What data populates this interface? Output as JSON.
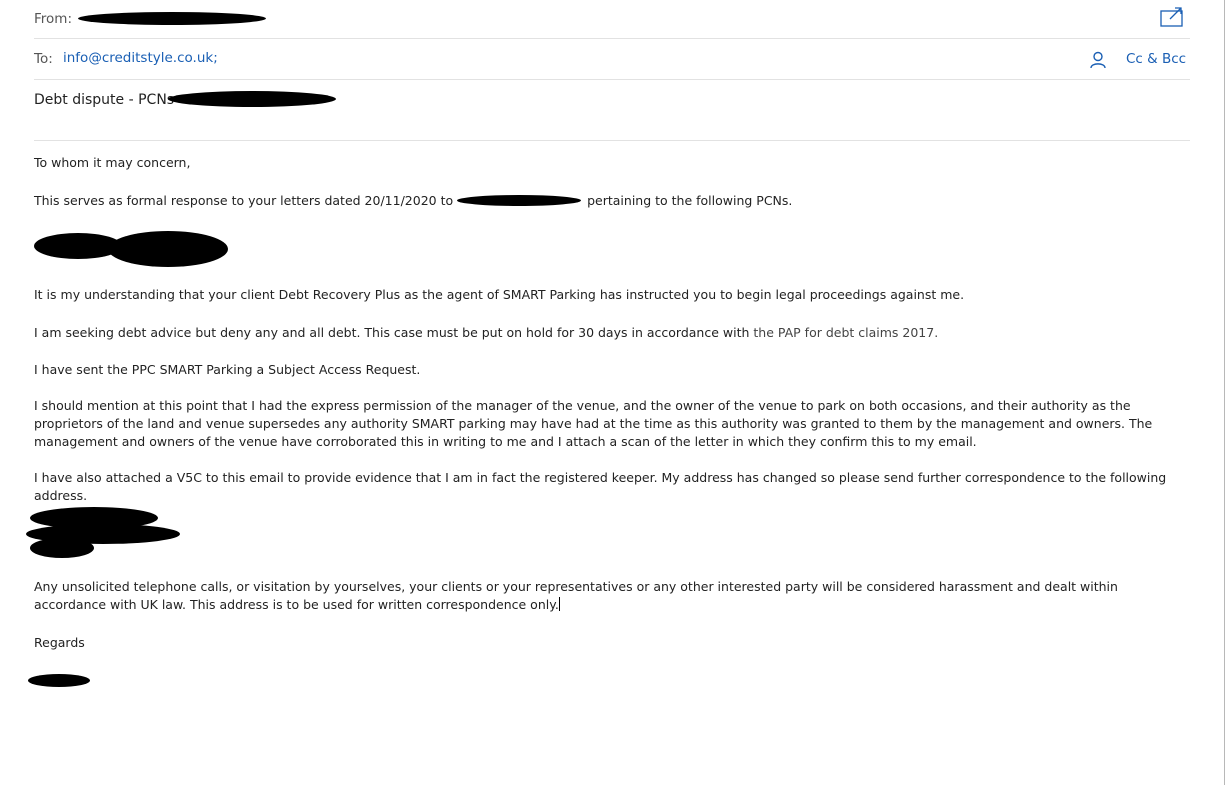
{
  "header": {
    "from_label": "From:",
    "to_label": "To:",
    "to_value": "info@creditstyle.co.uk;",
    "cc_bcc_label": "Cc & Bcc",
    "subject": "Debt dispute - PCNs"
  },
  "body": {
    "greeting": "To whom it may concern,",
    "p1_start": "This serves as formal response to your letters dated 20/11/2020 to",
    "p1_end": "pertaining to the following PCNs.",
    "p2": "It is my understanding that your client Debt Recovery Plus as the agent of SMART Parking has instructed you to begin legal proceedings against me.",
    "p3_start": "I am seeking debt advice but deny any and all debt. This case must be put on hold for 30 days in accordance with ",
    "p3_link": "the PAP for debt claims 2017.",
    "p4": "I have sent the PPC SMART Parking a Subject Access Request.",
    "p5": "I should mention at this point that I had the express permission of the manager of the venue, and the owner of the venue to park on both occasions, and their authority as the proprietors of the land and venue supersedes any authority SMART parking may have had at the time as this authority was granted to them by the management and owners. The management and owners of the venue have corroborated this in writing to me and I attach a scan of the letter in which they confirm this to my email.",
    "p6": "I have also attached a V5C to this email to provide evidence that I am in fact the registered keeper. My address has changed so please send further correspondence to the following address.",
    "p7": "Any unsolicited telephone calls, or visitation by yourselves, your clients or your representatives or any other interested party will be considered harassment and dealt within accordance with UK law. This address is to be used for written correspondence only.",
    "closing": "Regards"
  },
  "icons": {
    "popout": "popout-icon",
    "person": "person-icon"
  },
  "colors": {
    "accent": "#1a5fb4",
    "redaction": "#000000"
  }
}
